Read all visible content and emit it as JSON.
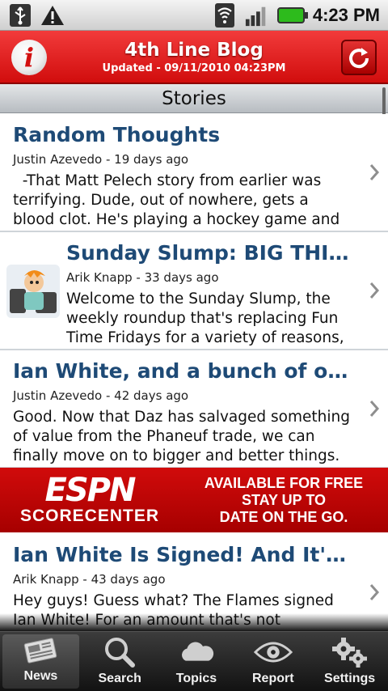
{
  "status_bar": {
    "time": "4:23 PM",
    "icons": [
      "usb-icon",
      "warning-icon",
      "wifi-icon",
      "signal-icon",
      "battery-icon"
    ]
  },
  "header": {
    "title": "4th Line Blog",
    "updated": "Updated - 09/11/2010 04:23PM",
    "left_icon": "info-icon",
    "right_icon": "refresh-icon",
    "accent": "#d81818"
  },
  "section": {
    "title": "Stories"
  },
  "stories": [
    {
      "title": "Random Thoughts",
      "meta": "Justin Azevedo - 19 days ago",
      "excerpt": "  -That Matt Pelech story from earlier was terrifying. Dude, out of nowhere, gets a blood clot. He's playing a hockey game and then an"
    },
    {
      "title": "Sunday Slump: BIG THINGS",
      "meta": "Arik Knapp - 33 days ago",
      "excerpt": "Welcome to the Sunday Slump, the weekly roundup that's replacing Fun Time Fridays for a variety of reasons,"
    },
    {
      "title": "Ian White, and a bunch of othe...",
      "meta": "Justin Azevedo - 42 days ago",
      "excerpt": "Good. Now that Daz has salvaged something of value from the Phaneuf trade, we can finally move on to bigger and better things. On"
    },
    {
      "title": "Ian White Is Signed! And It's N...",
      "meta": "Arik Knapp - 43 days ago",
      "excerpt": "Hey guys! Guess what? The Flames signed Ian White! For an amount that's not completely"
    }
  ],
  "ad": {
    "logo": "ESPN",
    "subtitle": "SCORECENTER",
    "line1": "AVAILABLE FOR FREE",
    "line2": "STAY UP TO",
    "line3": "DATE ON THE GO."
  },
  "tabs": [
    {
      "label": "News",
      "icon": "newspaper-icon"
    },
    {
      "label": "Search",
      "icon": "magnifier-icon"
    },
    {
      "label": "Topics",
      "icon": "cloud-icon"
    },
    {
      "label": "Report",
      "icon": "eye-icon"
    },
    {
      "label": "Settings",
      "icon": "gears-icon"
    }
  ]
}
